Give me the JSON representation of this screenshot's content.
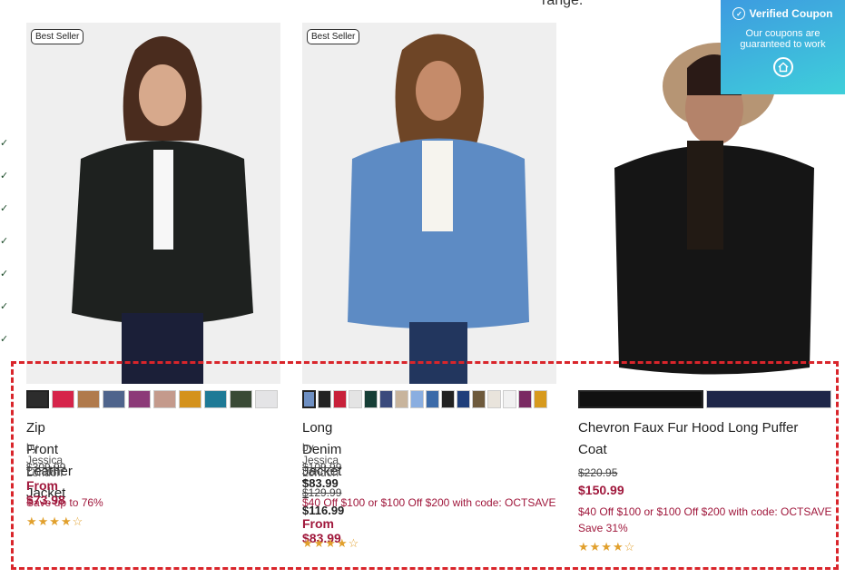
{
  "header": {
    "cut_text": "range."
  },
  "coupon": {
    "title": "Verified Coupon",
    "subtitle": "Our coupons are guaranteed to work",
    "icon": "home-icon"
  },
  "products": [
    {
      "badge": "Best Seller",
      "title": "Zip Front Leather Jacket",
      "brand": "by Jessica London",
      "was_price": "$309.99",
      "from_price": "From $73.98",
      "save_text": "Save up to 76%",
      "rating": "★★★★☆",
      "swatches": [
        "#2c2c2c",
        "#d6244a",
        "#b07a4c",
        "#4f648c",
        "#8c3a78",
        "#c49a8c",
        "#d4921c",
        "#1f7a96",
        "#3a4a36",
        "#e4e4e6"
      ]
    },
    {
      "badge": "Best Seller",
      "title": "Long Denim Jacket",
      "brand": "by Jessica London",
      "was_price": "$109.99 – $129.99",
      "range_price": "$83.99 – $116.99",
      "promo": "$40 Off $100 or $100 Off $200 with code: OCTSAVE",
      "from_price": "From $83.99",
      "rating": "★★★★☆",
      "swatches": [
        "#6e8fc2",
        "#222222",
        "#c8213a",
        "#163e36",
        "#3a4a7c",
        "#c8b49c",
        "#8aaee0",
        "#3b6aa8",
        "#222222",
        "#1f3e7a",
        "#6e5a3c",
        "#e9e4dc",
        "#f1f1f1",
        "#7a2a62",
        "#d79a1e"
      ]
    },
    {
      "title": "Chevron Faux Fur Hood Long Puffer Coat",
      "was_price": "$220.95",
      "price": "$150.99",
      "promo": "$40 Off $100 or $100 Off $200 with code: OCTSAVE",
      "save_text": "Save 31%",
      "rating": "★★★★☆",
      "swatches": [
        "#111111",
        "#1e2648"
      ]
    }
  ]
}
